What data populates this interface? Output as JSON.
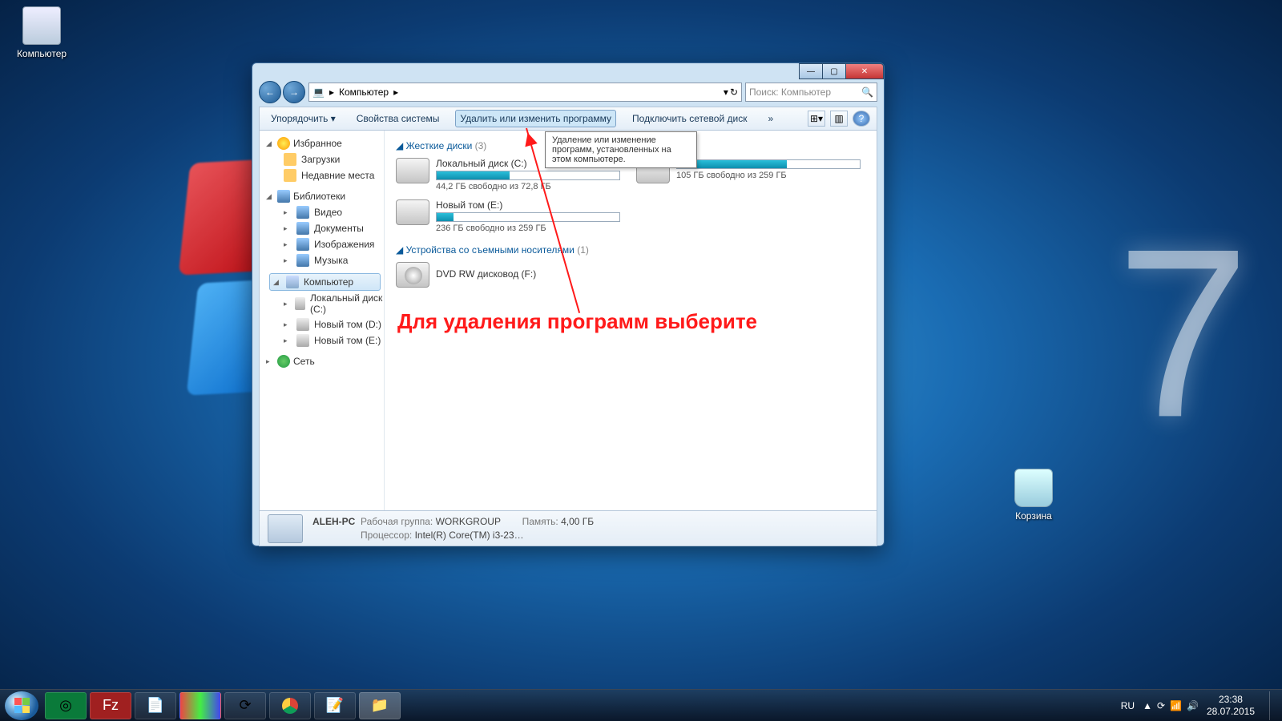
{
  "desktop": {
    "computer_label": "Компьютер",
    "bin_label": "Корзина"
  },
  "window": {
    "nav": {
      "back": "←",
      "fwd": "→"
    },
    "breadcrumb": {
      "root_icon": "💻",
      "sep": "▸",
      "loc": "Компьютер",
      "sep2": "▸"
    },
    "addr_drop": "▾",
    "refresh": "↻",
    "search": {
      "placeholder": "Поиск: Компьютер",
      "icon": "🔍"
    },
    "toolbar": {
      "organize": "Упорядочить ▾",
      "props": "Свойства системы",
      "uninstall": "Удалить или изменить программу",
      "mapdrive": "Подключить сетевой диск",
      "more": "»",
      "view": "⊞▾",
      "preview": "▥",
      "help": "?"
    },
    "tooltip": "Удаление или изменение программ, установленных на этом компьютере.",
    "sidebar": {
      "fav": "Избранное",
      "fav_items": [
        "Загрузки",
        "Недавние места"
      ],
      "lib": "Библиотеки",
      "lib_items": [
        "Видео",
        "Документы",
        "Изображения",
        "Музыка"
      ],
      "comp": "Компьютер",
      "comp_items": [
        "Локальный диск (C:)",
        "Новый том (D:)",
        "Новый том (E:)"
      ],
      "net": "Сеть"
    },
    "groups": {
      "hdd": {
        "title": "Жесткие диски",
        "count": "(3)"
      },
      "rem": {
        "title": "Устройства со съемными носителями",
        "count": "(1)"
      }
    },
    "drives": [
      {
        "name": "Локальный диск (C:)",
        "sub": "44,2 ГБ свободно из 72,8 ГБ",
        "fill": 40
      },
      {
        "name": "",
        "sub": "105 ГБ свободно из 259 ГБ",
        "fill": 60
      },
      {
        "name": "Новый том (E:)",
        "sub": "236 ГБ свободно из 259 ГБ",
        "fill": 9
      }
    ],
    "dvd": {
      "name": "DVD RW дисковод (F:)"
    },
    "status": {
      "name": "ALEH-PC",
      "wg_lbl": "Рабочая группа:",
      "wg": "WORKGROUP",
      "mem_lbl": "Память:",
      "mem": "4,00 ГБ",
      "cpu_lbl": "Процессор:",
      "cpu": "Intel(R) Core(TM) i3-23…"
    }
  },
  "annotation": "Для удаления программ выберите",
  "taskbar": {
    "lang": "RU",
    "time": "23:38",
    "date": "28.07.2015"
  }
}
